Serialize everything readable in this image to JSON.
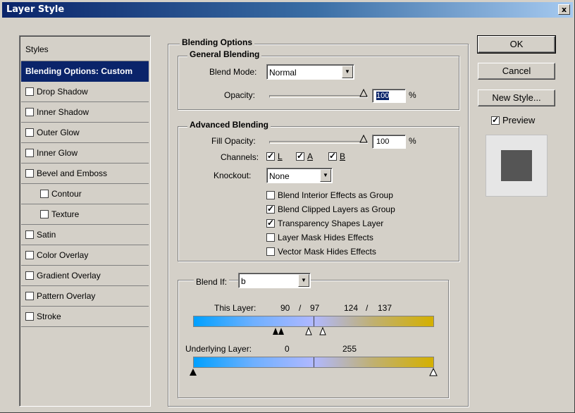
{
  "window": {
    "title": "Layer Style",
    "close_label": "x"
  },
  "styles": {
    "header": "Styles",
    "selected": "Blending Options: Custom",
    "items": [
      {
        "label": "Drop Shadow",
        "checked": false,
        "sub": false
      },
      {
        "label": "Inner Shadow",
        "checked": false,
        "sub": false
      },
      {
        "label": "Outer Glow",
        "checked": false,
        "sub": false
      },
      {
        "label": "Inner Glow",
        "checked": false,
        "sub": false
      },
      {
        "label": "Bevel and Emboss",
        "checked": false,
        "sub": false
      },
      {
        "label": "Contour",
        "checked": false,
        "sub": true
      },
      {
        "label": "Texture",
        "checked": false,
        "sub": true
      },
      {
        "label": "Satin",
        "checked": false,
        "sub": false
      },
      {
        "label": "Color Overlay",
        "checked": false,
        "sub": false
      },
      {
        "label": "Gradient Overlay",
        "checked": false,
        "sub": false
      },
      {
        "label": "Pattern Overlay",
        "checked": false,
        "sub": false
      },
      {
        "label": "Stroke",
        "checked": false,
        "sub": false
      }
    ]
  },
  "blending": {
    "title": "Blending Options",
    "general": {
      "title": "General Blending",
      "blend_mode_label": "Blend Mode:",
      "blend_mode_value": "Normal",
      "opacity_label": "Opacity:",
      "opacity_value": "100",
      "opacity_unit": "%"
    },
    "advanced": {
      "title": "Advanced Blending",
      "fill_opacity_label": "Fill Opacity:",
      "fill_opacity_value": "100",
      "fill_opacity_unit": "%",
      "channels_label": "Channels:",
      "channels": [
        {
          "label": "L",
          "checked": true
        },
        {
          "label": "A",
          "checked": true
        },
        {
          "label": "B",
          "checked": true
        }
      ],
      "knockout_label": "Knockout:",
      "knockout_value": "None",
      "options": [
        {
          "label": "Blend Interior Effects as Group",
          "checked": false
        },
        {
          "label": "Blend Clipped Layers as Group",
          "checked": true
        },
        {
          "label": "Transparency Shapes Layer",
          "checked": true
        },
        {
          "label": "Layer Mask Hides Effects",
          "checked": false
        },
        {
          "label": "Vector Mask Hides Effects",
          "checked": false
        }
      ]
    },
    "blend_if": {
      "label": "Blend If:",
      "value": "b",
      "this_layer_label": "This Layer:",
      "this_layer_low": "90",
      "this_layer_sep1": "/",
      "this_layer_low2": "97",
      "this_layer_high": "124",
      "this_layer_sep2": "/",
      "this_layer_high2": "137",
      "underlying_label": "Underlying Layer:",
      "underlying_low": "0",
      "underlying_high": "255"
    }
  },
  "buttons": {
    "ok": "OK",
    "cancel": "Cancel",
    "new_style": "New Style...",
    "preview_label": "Preview",
    "preview_checked": true
  },
  "colors": {
    "title_start": "#0a246a",
    "title_end": "#a6caf0",
    "selection": "#0a246a",
    "ramp_left": "#00a0ff",
    "ramp_right": "#d4b000",
    "preview_swatch": "#555555"
  }
}
